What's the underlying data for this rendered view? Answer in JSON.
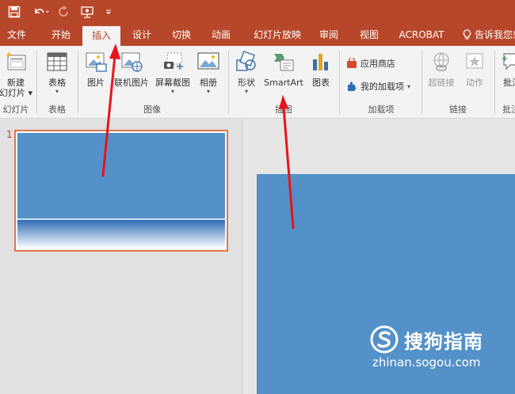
{
  "colors": {
    "accent": "#b7472a",
    "ribbon_bg": "#f3f3f3",
    "slide_blue": "#5491c8",
    "arrow_red": "#e8141b"
  },
  "quick_access": {
    "save_icon": "save-icon",
    "undo_icon": "undo-icon",
    "redo_icon": "redo-icon",
    "start_icon": "start-from-beginning-icon",
    "customize_icon": "customize-qat-icon"
  },
  "tabs": [
    {
      "label": "文件"
    },
    {
      "label": "开始"
    },
    {
      "label": "插入"
    },
    {
      "label": "设计"
    },
    {
      "label": "切换"
    },
    {
      "label": "动画"
    },
    {
      "label": "幻灯片放映"
    },
    {
      "label": "审阅"
    },
    {
      "label": "视图"
    },
    {
      "label": "ACROBAT"
    }
  ],
  "active_tab": "插入",
  "tell_me": "告诉我您想",
  "ribbon": {
    "new_slide": {
      "line1": "新建",
      "line2": "幻灯片"
    },
    "table": "表格",
    "picture": "图片",
    "online_picture": "联机图片",
    "screenshot": "屏幕截图",
    "album": "相册",
    "shapes": "形状",
    "smartart": "SmartArt",
    "chart": "图表",
    "store": "应用商店",
    "my_addins": "我的加载项",
    "hyperlink": "超链接",
    "action": "动作",
    "comment": "批注",
    "groups": {
      "slides": "幻灯片",
      "tables": "表格",
      "images": "图像",
      "illustrations": "插图",
      "addins": "加载项",
      "links": "链接",
      "comments": "批注"
    }
  },
  "thumbnails": [
    {
      "number": "1"
    }
  ],
  "watermark": {
    "name": "搜狗指南",
    "url": "zhinan.sogou.com"
  }
}
